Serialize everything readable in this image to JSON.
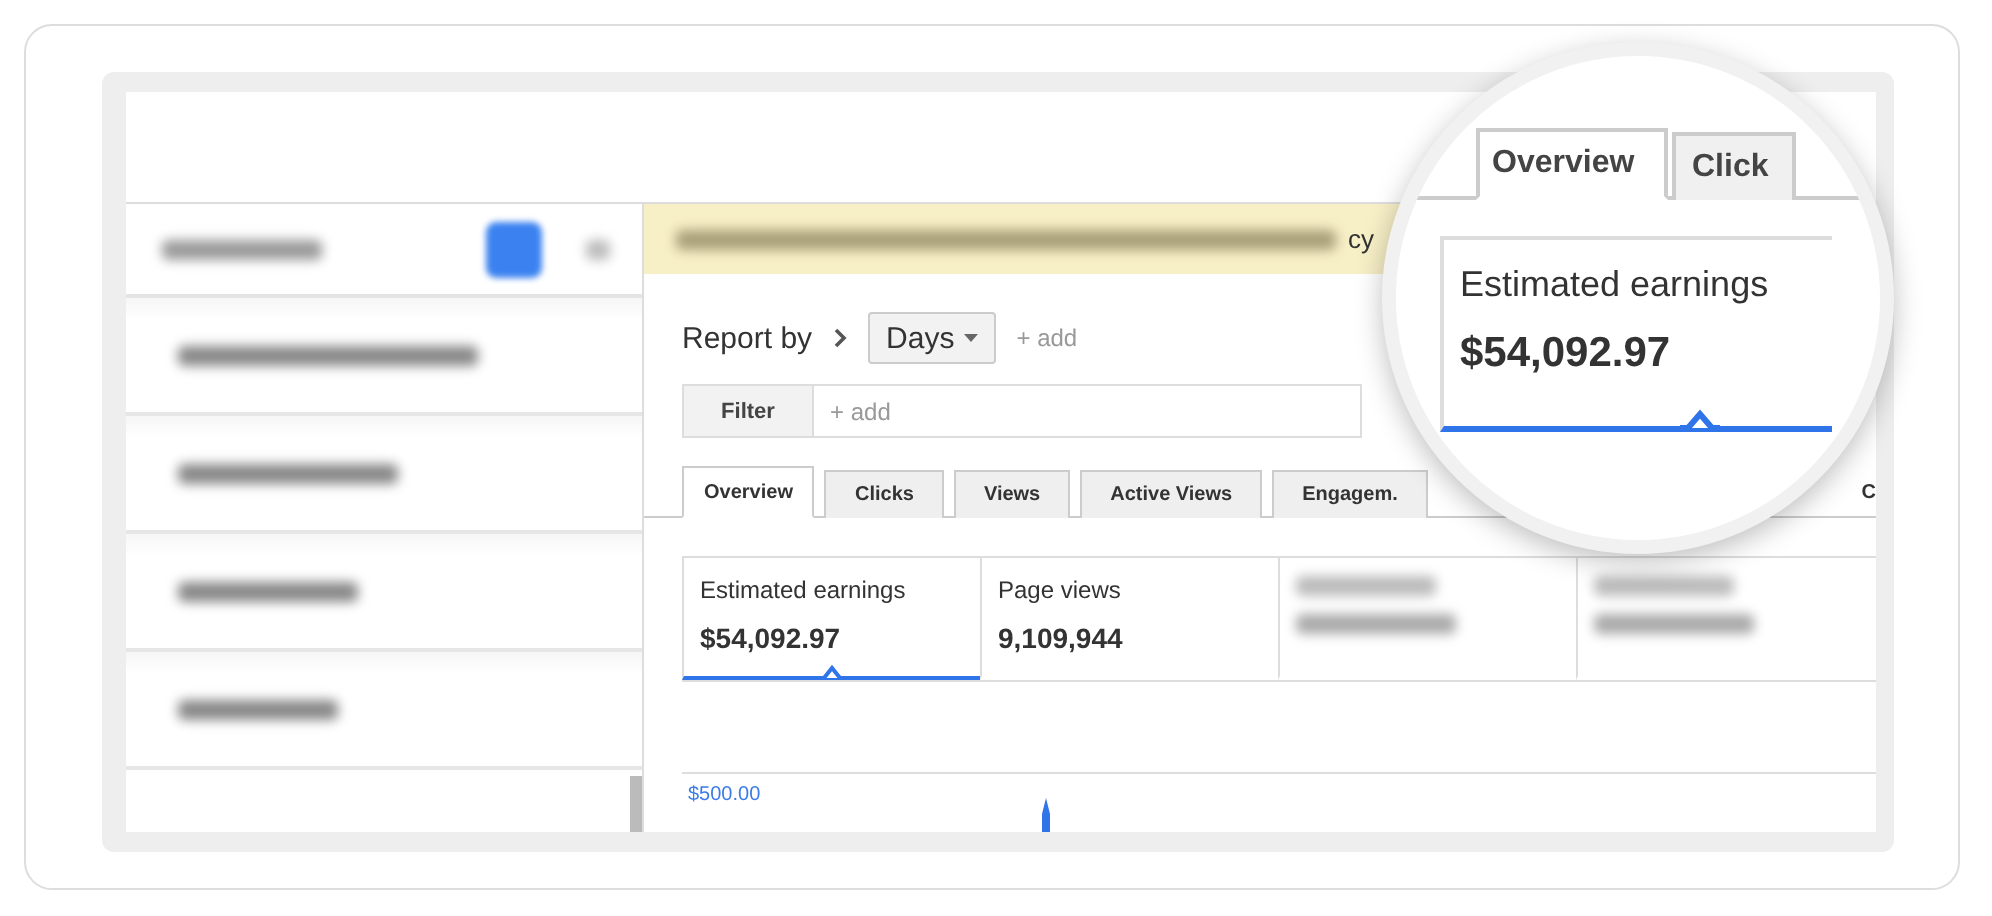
{
  "sidebar": {
    "search": {
      "kind": "blurred"
    },
    "items": [
      {
        "kind": "blurred"
      },
      {
        "kind": "blurred"
      },
      {
        "kind": "blurred"
      },
      {
        "kind": "blurred"
      }
    ]
  },
  "banner": {
    "text_tail": "cy"
  },
  "report_by": {
    "label": "Report by",
    "dimension": "Days",
    "add": "+ add"
  },
  "filter": {
    "button": "Filter",
    "placeholder": "+ add"
  },
  "tabs": [
    {
      "label": "Overview",
      "selected": true
    },
    {
      "label": "Clicks",
      "selected": false
    },
    {
      "label": "Views",
      "selected": false
    },
    {
      "label": "Active Views",
      "selected": false
    },
    {
      "label": "Engagem.",
      "selected": false
    }
  ],
  "tab_tail": "C",
  "metrics": [
    {
      "kind": "text",
      "label": "Estimated earnings",
      "value": "$54,092.97",
      "selected": true
    },
    {
      "kind": "text",
      "label": "Page views",
      "value": "9,109,944",
      "selected": false
    },
    {
      "kind": "blurred",
      "selected": false
    },
    {
      "kind": "blurred",
      "selected": false
    }
  ],
  "chart": {
    "y_label": "$500.00"
  },
  "magnifier": {
    "tabs": [
      {
        "label": "Overview",
        "selected": true
      },
      {
        "label": "Click",
        "selected": false
      }
    ],
    "metric": {
      "label": "Estimated earnings",
      "value": "$54,092.97",
      "selected": true
    }
  }
}
